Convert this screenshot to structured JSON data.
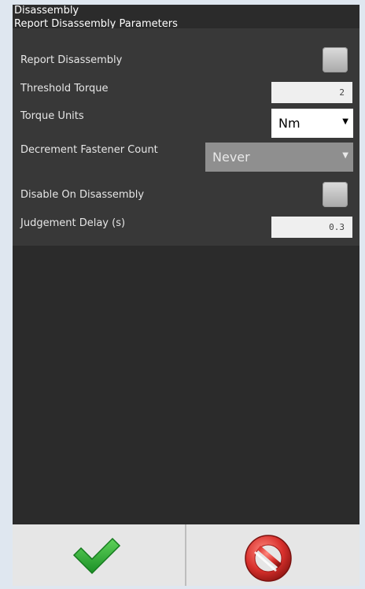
{
  "panel": {
    "title": "Disassembly",
    "group_title": "Report Disassembly Parameters"
  },
  "fields": {
    "report_disassembly": {
      "label": "Report Disassembly",
      "checked": false
    },
    "threshold_torque": {
      "label": "Threshold Torque",
      "value": "2"
    },
    "torque_units": {
      "label": "Torque Units",
      "value": "Nm"
    },
    "decrement_fastener_count": {
      "label": "Decrement Fastener Count",
      "value": "Never"
    },
    "disable_on_disassembly": {
      "label": "Disable On Disassembly",
      "checked": false
    },
    "judgement_delay": {
      "label": "Judgement Delay (s)",
      "value": "0.3"
    }
  },
  "buttons": {
    "ok_icon": "checkmark-icon",
    "cancel_icon": "cancel-icon"
  },
  "colors": {
    "ok_green": "#2fae3a",
    "cancel_red": "#d8302c"
  }
}
